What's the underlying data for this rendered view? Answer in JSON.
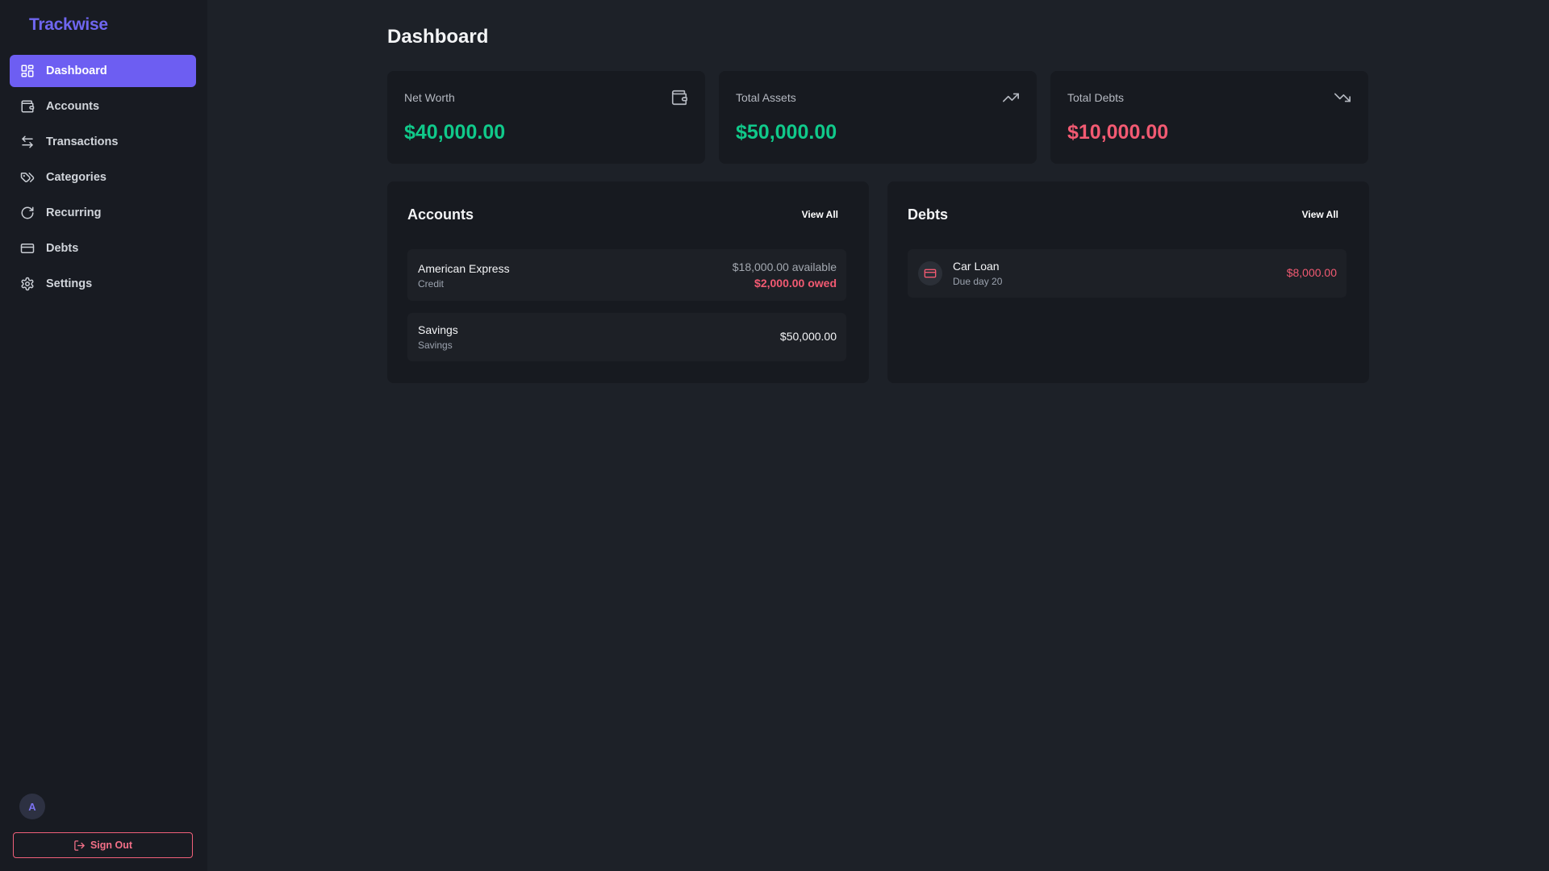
{
  "app": {
    "name": "Trackwise"
  },
  "sidebar": {
    "items": [
      {
        "label": "Dashboard",
        "icon": "dashboard-icon",
        "active": true
      },
      {
        "label": "Accounts",
        "icon": "wallet-icon"
      },
      {
        "label": "Transactions",
        "icon": "arrows-left-right-icon"
      },
      {
        "label": "Categories",
        "icon": "tags-icon"
      },
      {
        "label": "Recurring",
        "icon": "refresh-icon"
      },
      {
        "label": "Debts",
        "icon": "credit-card-icon"
      },
      {
        "label": "Settings",
        "icon": "gear-icon"
      }
    ],
    "avatar_initial": "A",
    "sign_out_label": "Sign Out"
  },
  "page": {
    "title": "Dashboard"
  },
  "stats": [
    {
      "label": "Net Worth",
      "value": "$40,000.00",
      "icon": "wallet-icon",
      "color": "#10c98a"
    },
    {
      "label": "Total Assets",
      "value": "$50,000.00",
      "icon": "trending-up-icon",
      "color": "#10c98a"
    },
    {
      "label": "Total Debts",
      "value": "$10,000.00",
      "icon": "trending-down-icon",
      "color": "#f25a72"
    }
  ],
  "accounts_panel": {
    "title": "Accounts",
    "view_all": "View All",
    "items": [
      {
        "name": "American Express",
        "type": "Credit",
        "available": "$18,000.00 available",
        "owed": "$2,000.00 owed"
      },
      {
        "name": "Savings",
        "type": "Savings",
        "balance": "$50,000.00"
      }
    ]
  },
  "debts_panel": {
    "title": "Debts",
    "view_all": "View All",
    "items": [
      {
        "name": "Car Loan",
        "due": "Due day 20",
        "amount": "$8,000.00",
        "icon": "credit-card-icon"
      }
    ]
  },
  "colors": {
    "accent": "#6d5ef2",
    "positive": "#10c98a",
    "negative": "#f25a72"
  }
}
